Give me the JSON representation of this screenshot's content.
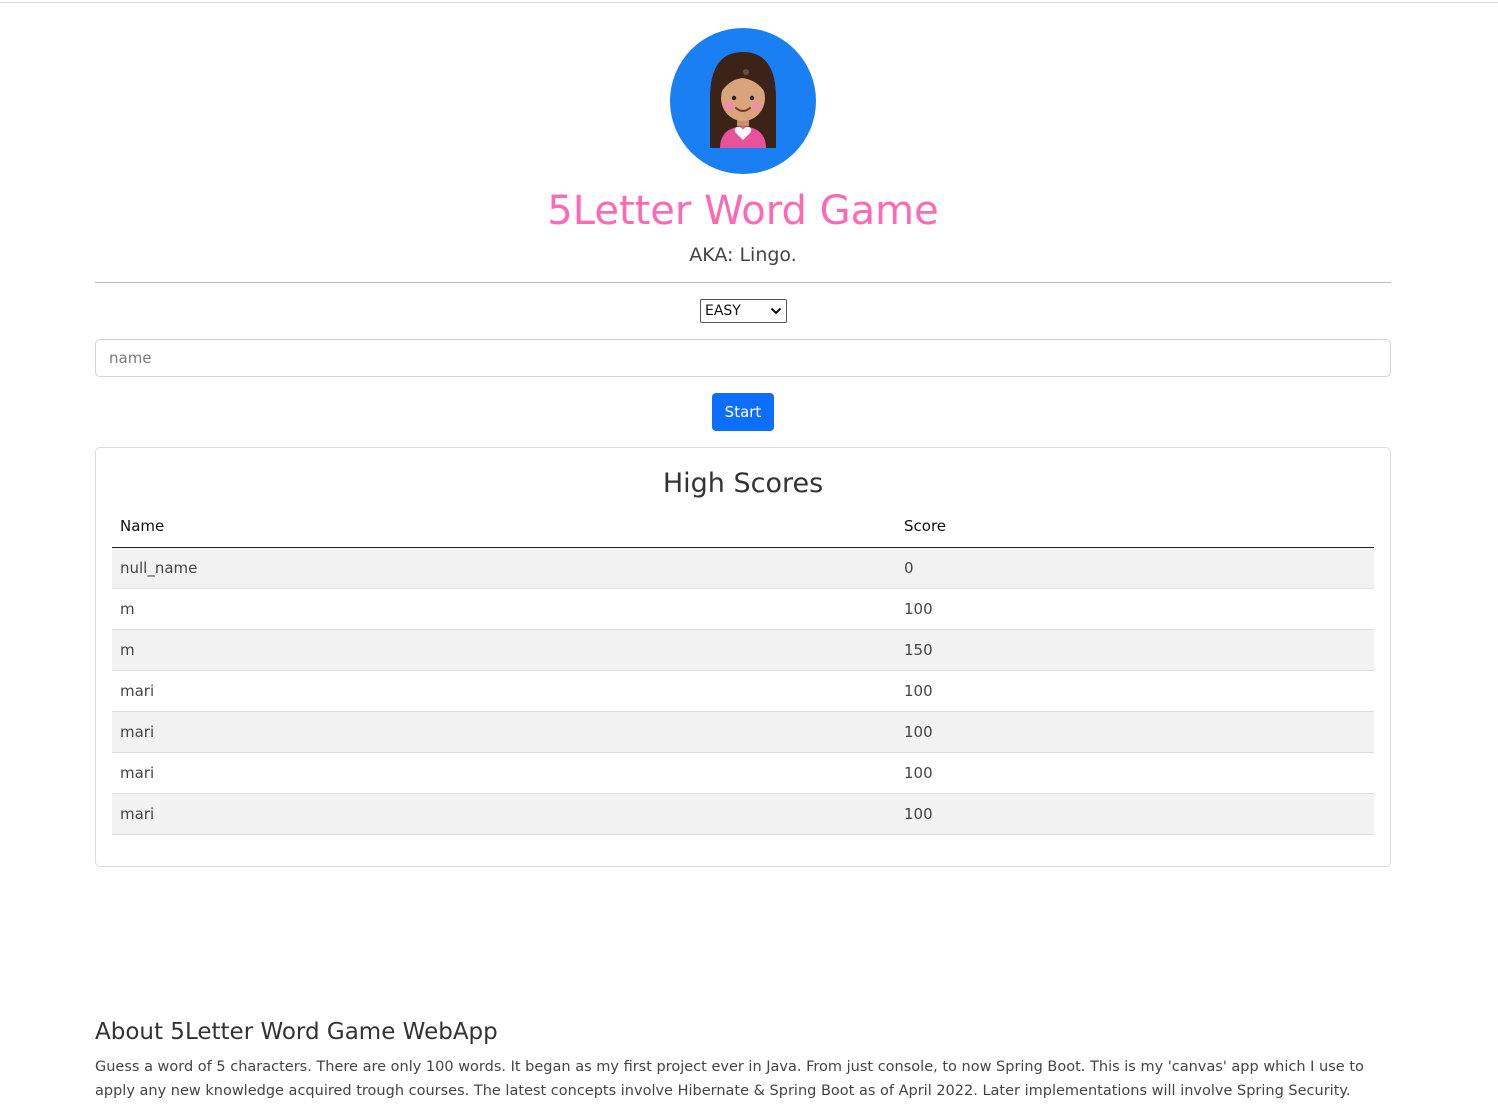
{
  "header": {
    "title": "5Letter Word Game",
    "subtitle": "AKA: Lingo."
  },
  "form": {
    "level_options": [
      "EASY"
    ],
    "level_selected": "EASY",
    "name_placeholder": "name",
    "name_value": "",
    "start_label": "Start"
  },
  "high_scores": {
    "title": "High Scores",
    "columns": [
      "Name",
      "Score"
    ],
    "rows": [
      {
        "name": "null_name",
        "score": "0"
      },
      {
        "name": "m",
        "score": "100"
      },
      {
        "name": "m",
        "score": "150"
      },
      {
        "name": "mari",
        "score": "100"
      },
      {
        "name": "mari",
        "score": "100"
      },
      {
        "name": "mari",
        "score": "100"
      },
      {
        "name": "mari",
        "score": "100"
      }
    ]
  },
  "about": {
    "title": "About 5Letter Word Game WebApp",
    "text": "Guess a word of 5 characters. There are only 100 words. It began as my first project ever in Java. From just console, to now Spring Boot. This is my 'canvas' app which I use to apply any new knowledge acquired trough courses. The latest concepts involve Hibernate & Spring Boot as of April 2022. Later implementations will involve Spring Security."
  },
  "colors": {
    "accent_pink": "#ff69b4",
    "primary_blue": "#0d6efd",
    "avatar_bg": "#1a7ff2"
  },
  "icons": {
    "avatar": "girl-avatar-icon",
    "select_chevron": "chevron-down-icon"
  }
}
